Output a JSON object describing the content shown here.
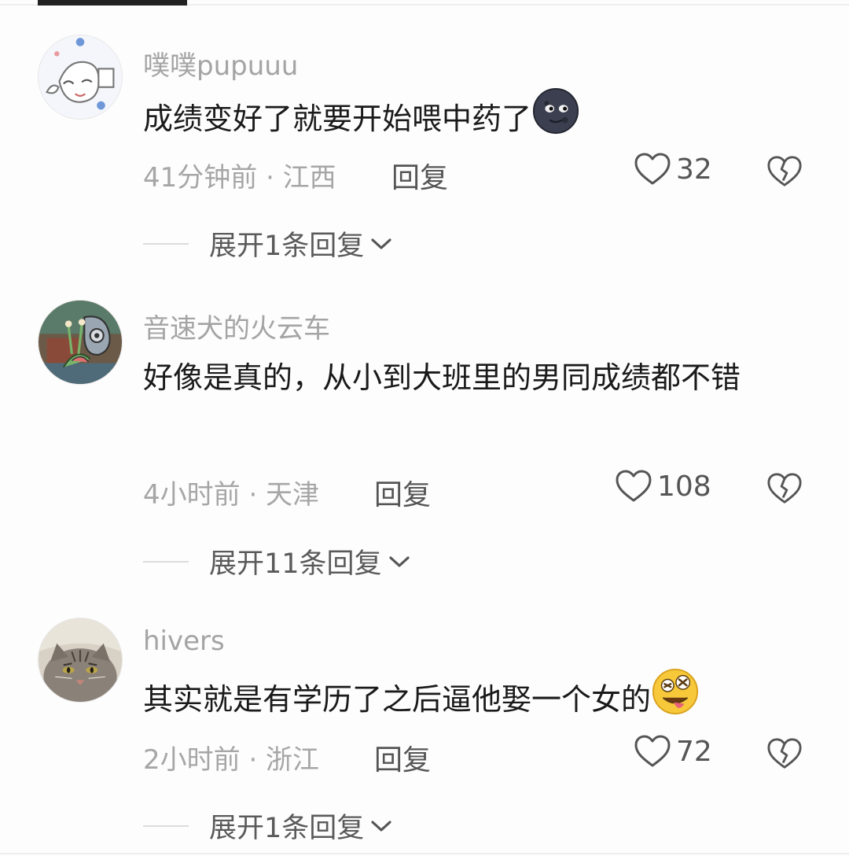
{
  "comments": [
    {
      "username": "噗噗pupuuu",
      "text": "成绩变好了就要开始喂中药了",
      "emoji": "new-moon-face-emoji",
      "time": "41分钟前 · 江西",
      "reply_label": "回复",
      "likes": "32",
      "expand_label": "展开1条回复"
    },
    {
      "username": "音速犬的火云车",
      "text": "好像是真的，从小到大班里的男同成绩都不错",
      "time": "4小时前 · 天津",
      "reply_label": "回复",
      "likes": "108",
      "expand_label": "展开11条回复"
    },
    {
      "username": "hivers",
      "text": "其实就是有学历了之后逼他娶一个女的",
      "emoji": "zany-face-emoji",
      "time": "2小时前 · 浙江",
      "reply_label": "回复",
      "likes": "72",
      "expand_label": "展开1条回复"
    }
  ],
  "colors": {
    "username": "#a4a4a4",
    "text": "#1a1a1a",
    "meta": "#a6a6a6",
    "action": "#555555"
  }
}
